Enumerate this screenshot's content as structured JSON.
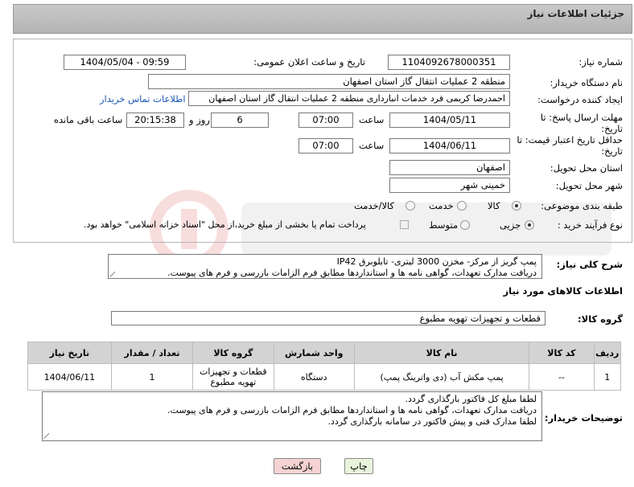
{
  "header": {
    "title": "جزئیات اطلاعات نیاز"
  },
  "form": {
    "need_number_label": "شماره نیاز:",
    "need_number": "1104092678000351",
    "announce_label": "تاریخ و ساعت اعلان عمومی:",
    "announce_value": "1404/05/04 - 09:59",
    "buyer_org_label": "نام دستگاه خریدار:",
    "buyer_org": "منطقه 2 عملیات انتقال گاز استان اصفهان",
    "requester_label": "ایجاد کننده درخواست:",
    "requester": "احمدرضا کریمی فرد خدمات انبارداری منطقه 2 عملیات انتقال گاز استان اصفهان",
    "contact_link": "اطلاعات تماس خریدار",
    "deadline_label": "مهلت ارسال پاسخ: تا تاریخ:",
    "deadline_date": "1404/05/11",
    "time_label": "ساعت",
    "deadline_time": "07:00",
    "days_value": "6",
    "days_label": "روز و",
    "remaining_time": "20:15:38",
    "remaining_label": "ساعت باقی مانده",
    "validity_label": "حداقل تاریخ اعتبار قیمت: تا تاریخ:",
    "validity_date": "1404/06/11",
    "validity_time": "07:00",
    "province_label": "استان محل تحویل:",
    "province": "اصفهان",
    "city_label": "شهر محل تحویل:",
    "city": "خمینی شهر",
    "category_label": "طبقه بندی موضوعی:",
    "category_options": [
      "کالا",
      "خدمت",
      "کالا/خدمت"
    ],
    "category_selected": "کالا",
    "process_label": "نوع فرآیند خرید :",
    "process_options": [
      "جزیی",
      "متوسط"
    ],
    "process_selected": "جزیی",
    "payment_note": "پرداخت تمام یا بخشی از مبلغ خرید،از محل \"اسناد خزانه اسلامی\" خواهد بود."
  },
  "description": {
    "label": "شرح کلی نیاز:",
    "text": "پمپ گریز از مرکز- مخزن 3000 لیتری- تابلوبرق IP42\nدریافت مدارک تعهدات، گواهی نامه ها و استانداردها مطابق فرم الزامات بازرسی و فرم های پیوست."
  },
  "goods": {
    "section_title": "اطلاعات کالاهای مورد نیاز",
    "group_label": "گروه کالا:",
    "group_value": "قطعات و تجهیزات تهویه مطبوع",
    "columns": [
      "ردیف",
      "کد کالا",
      "نام کالا",
      "واحد شمارش",
      "گروه کالا",
      "تعداد / مقدار",
      "تاریخ نیاز"
    ],
    "rows": [
      [
        "1",
        "--",
        "پمپ مکش آب (دی واترینگ پمپ)",
        "دستگاه",
        "قطعات و تجهیزات تهویه مطبوع",
        "1",
        "1404/06/11"
      ]
    ]
  },
  "buyer_notes": {
    "label": "توضیحات خریدار:",
    "text": "لطفا مبلغ کل فاکتور بارگذاری گردد.\nدریافت مدارک تعهدات، گواهی نامه ها و استانداردها مطابق فرم الزامات بازرسی و فرم های پیوست.\nلطفا مدارک فنی و پیش فاکتور در سامانه بارگذاری گردد."
  },
  "buttons": {
    "print": "چاپ",
    "back": "بازگشت"
  },
  "colors": {
    "header_bg": "#bdbdbd",
    "link": "#1a56b5",
    "back_button_bg": "#f6d3d3",
    "print_button_bg": "#e8f3dc"
  }
}
